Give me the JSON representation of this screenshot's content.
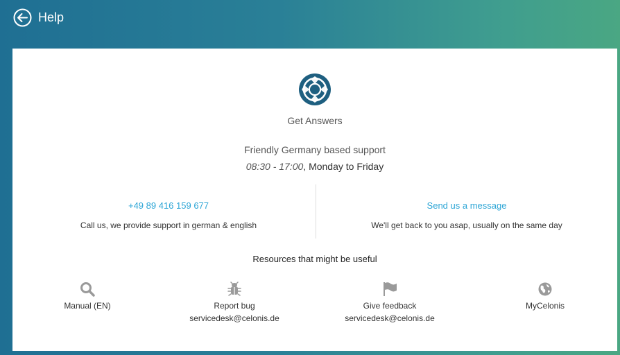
{
  "header": {
    "title": "Help",
    "back_icon": "circle-arrow-left-icon"
  },
  "hero": {
    "icon": "lifebuoy-icon",
    "title": "Get Answers",
    "support_line": "Friendly Germany based support",
    "hours": "08:30 - 17:00",
    "days": "Monday to Friday"
  },
  "contact": {
    "phone": {
      "link": "+49 89 416 159 677",
      "description": "Call us, we provide support in german & english"
    },
    "message": {
      "link": "Send us a message",
      "description": "We'll get back to you asap, usually on the same day"
    }
  },
  "resources": {
    "title": "Resources that might be useful",
    "items": [
      {
        "label": "Manual (EN)",
        "sub": "",
        "icon": "search-icon"
      },
      {
        "label": "Report bug",
        "sub": "servicedesk@celonis.de",
        "icon": "bug-icon"
      },
      {
        "label": "Give feedback",
        "sub": "servicedesk@celonis.de",
        "icon": "flag-icon"
      },
      {
        "label": "MyCelonis",
        "sub": "",
        "icon": "globe-icon"
      }
    ]
  },
  "colors": {
    "link": "#2ea6d6",
    "icon_gray": "#9a9a9a",
    "lifebuoy": "#1e5f80"
  }
}
